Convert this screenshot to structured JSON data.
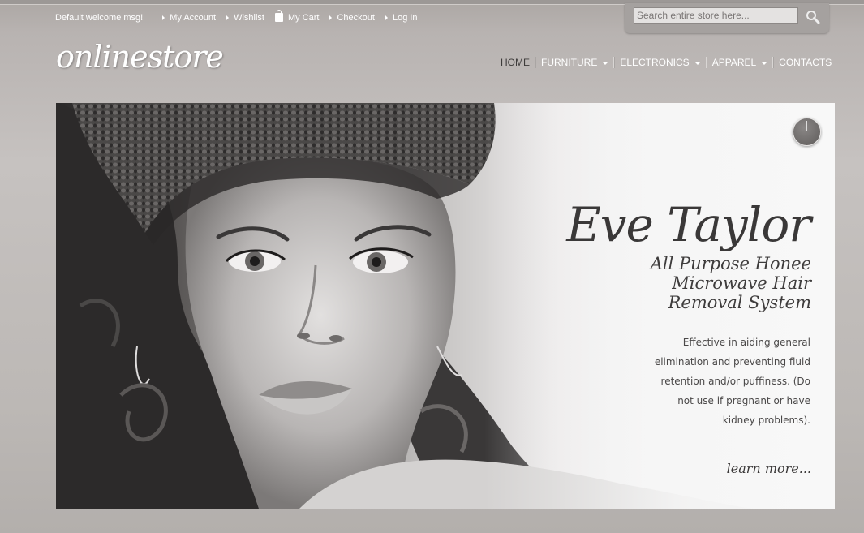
{
  "header": {
    "welcome": "Default welcome msg!",
    "links": [
      "My Account",
      "Wishlist",
      "My Cart",
      "Checkout",
      "Log In"
    ],
    "search_placeholder": "Search entire store here...",
    "logo": "onlinestore"
  },
  "nav": {
    "items": [
      "HOME",
      "FURNITURE",
      "ELECTRONICS",
      "APPAREL",
      "CONTACTS"
    ]
  },
  "banner": {
    "title": "Eve Taylor",
    "subtitle": [
      "All Purpose Honee",
      "Microwave Hair",
      "Removal System"
    ],
    "description": [
      "Effective in aiding general",
      "elimination and preventing fluid",
      "retention and/or puffiness. (Do",
      "not use if pregnant or have",
      "kidney problems)."
    ],
    "cta": "learn more..."
  },
  "icons": {
    "search": "magnifier-icon",
    "cart": "shopping-bag-icon",
    "slider_control": "pause-icon"
  }
}
